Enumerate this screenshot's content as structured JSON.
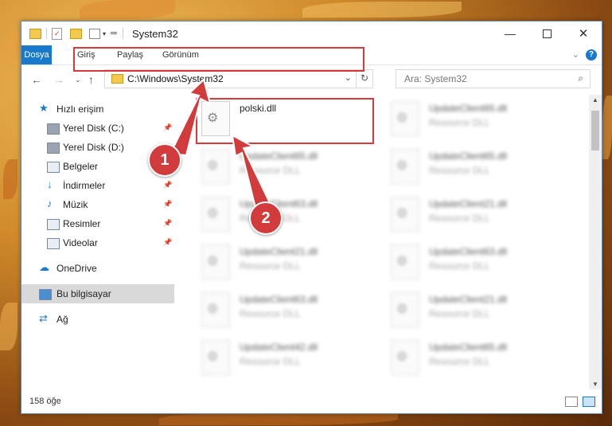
{
  "window": {
    "title": "System32"
  },
  "ribbon": {
    "tabs": [
      "Dosya",
      "Giriş",
      "Paylaş",
      "Görünüm"
    ]
  },
  "nav": {
    "path": "C:\\Windows\\System32",
    "search_placeholder": "Ara: System32"
  },
  "sidebar": {
    "items": [
      {
        "label": "Hızlı erişim",
        "icon": "star-icon",
        "pinned": false
      },
      {
        "label": "Yerel Disk (C:)",
        "icon": "drive-icon",
        "pinned": true
      },
      {
        "label": "Yerel Disk (D:)",
        "icon": "drive-icon",
        "pinned": false
      },
      {
        "label": "Belgeler",
        "icon": "documents-icon",
        "pinned": true
      },
      {
        "label": "İndirmeler",
        "icon": "download-icon",
        "pinned": true
      },
      {
        "label": "Müzik",
        "icon": "music-icon",
        "pinned": true
      },
      {
        "label": "Resimler",
        "icon": "pictures-icon",
        "pinned": true
      },
      {
        "label": "Videolar",
        "icon": "videos-icon",
        "pinned": true
      },
      {
        "label": "OneDrive",
        "icon": "cloud-icon",
        "pinned": false
      },
      {
        "label": "Bu bilgisayar",
        "icon": "computer-icon",
        "pinned": false,
        "selected": true
      },
      {
        "label": "Ağ",
        "icon": "network-icon",
        "pinned": false
      }
    ]
  },
  "files": [
    {
      "name": "polski.dll",
      "type": ""
    },
    {
      "name": "UpdateClient65.dll",
      "type": "Resource DLL"
    },
    {
      "name": "UpdateClient65.dll",
      "type": "Resource DLL"
    },
    {
      "name": "UpdateClient65.dll",
      "type": "Resource DLL"
    },
    {
      "name": "UpdateClient63.dll",
      "type": "Resource DLL"
    },
    {
      "name": "UpdateClient21.dll",
      "type": "Resource DLL"
    },
    {
      "name": "UpdateClient21.dll",
      "type": "Resource DLL"
    },
    {
      "name": "UpdateClient63.dll",
      "type": "Resource DLL"
    },
    {
      "name": "UpdateClient63.dll",
      "type": "Resource DLL"
    },
    {
      "name": "UpdateClient21.dll",
      "type": "Resource DLL"
    },
    {
      "name": "UpdateClient42.dll",
      "type": "Resource DLL"
    },
    {
      "name": "UpdateClient65.dll",
      "type": "Resource DLL"
    }
  ],
  "status": {
    "count": "158 öğe"
  },
  "callouts": {
    "step1": "1",
    "step2": "2"
  },
  "colors": {
    "accent": "#1979ca",
    "highlight": "#d73a3a",
    "badge": "#d23b3b"
  }
}
